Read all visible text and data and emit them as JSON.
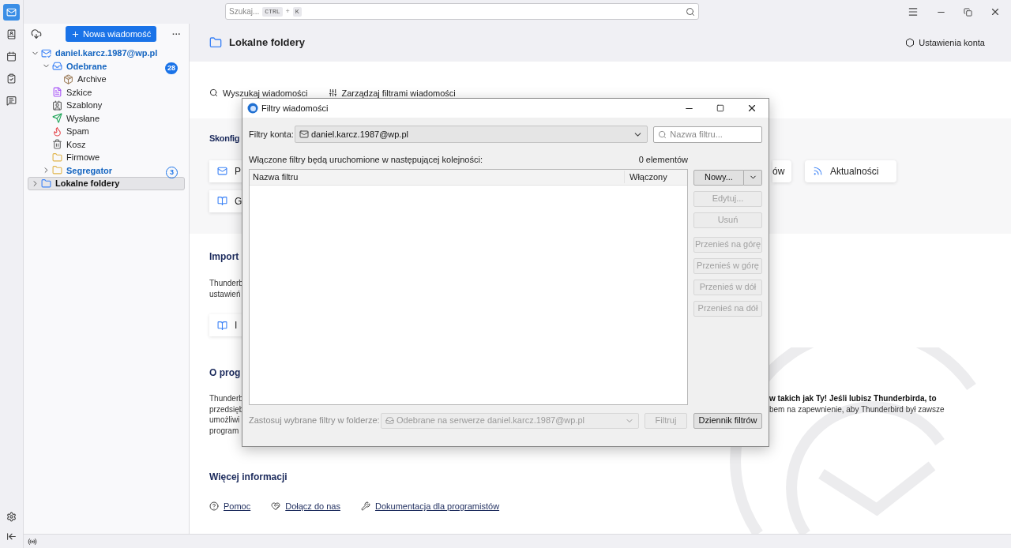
{
  "top_bar": {
    "search": {
      "placeholder": "Szukaj...",
      "keys": [
        "CTRL",
        "+",
        "K"
      ]
    }
  },
  "spaces": [
    {
      "kind": "mail",
      "selected": true
    },
    {
      "kind": "contacts",
      "selected": false
    },
    {
      "kind": "calendar",
      "selected": false
    },
    {
      "kind": "tasks",
      "selected": false
    },
    {
      "kind": "chat",
      "selected": false
    }
  ],
  "folder_pane": {
    "new_button": "Nowa wiadomość",
    "more": "···",
    "tree": [
      {
        "label": "daniel.karcz.1987@wp.pl",
        "kind": "account",
        "expanded": true,
        "unread": true,
        "selected": false,
        "children": [
          {
            "label": "Odebrane",
            "kind": "inbox",
            "expanded": true,
            "unread": true,
            "selected": false,
            "count": "28",
            "filled": true,
            "children": [
              {
                "label": "Archive",
                "kind": "archive",
                "unread": false,
                "selected": false
              }
            ]
          },
          {
            "label": "Szkice",
            "kind": "drafts",
            "unread": false,
            "selected": false
          },
          {
            "label": "Szablony",
            "kind": "templates",
            "unread": false,
            "selected": false
          },
          {
            "label": "Wysłane",
            "kind": "sent",
            "unread": false,
            "selected": false
          },
          {
            "label": "Spam",
            "kind": "spam",
            "unread": false,
            "selected": false
          },
          {
            "label": "Kosz",
            "kind": "trash",
            "unread": false,
            "selected": false
          },
          {
            "label": "Firmowe",
            "kind": "folder",
            "unread": false,
            "selected": false
          },
          {
            "label": "Segregator",
            "kind": "folder",
            "expanded": false,
            "unread": true,
            "selected": false,
            "count": "3",
            "filled": false
          }
        ]
      },
      {
        "label": "Lokalne foldery",
        "kind": "local",
        "expanded": false,
        "unread": false,
        "selected": true
      }
    ]
  },
  "main": {
    "title": "Lokalne foldery",
    "account_settings": "Ustawienia konta",
    "actions": [
      "Wyszukaj wiadomości",
      "Zarządzaj filtrami wiadomości"
    ],
    "setup_heading": "Skonfig",
    "setup_cards_left": [
      {
        "label": "P",
        "kind": "mail"
      },
      {
        "label": "G",
        "kind": "address"
      }
    ],
    "setup_cards_right": [
      {
        "label": "ów",
        "kind": "none"
      },
      {
        "label": "Aktualności",
        "kind": "feed"
      }
    ],
    "import_heading": "Import",
    "import_text": [
      "Thunderb",
      "ustawień"
    ],
    "import_card": "I",
    "about_heading": "O prog",
    "about_text_left": [
      "Thunderb",
      "przedsięb",
      "umożliwi",
      "program"
    ],
    "about_text_right": [
      "w takich jak Ty! Jeśli lubisz Thunderbirda, to",
      "bem na zapewnienie, aby Thunderbird był zawsze"
    ],
    "more_heading": "Więcej informacji",
    "links": [
      {
        "label": "Pomoc",
        "kind": "help"
      },
      {
        "label": "Dołącz do nas",
        "kind": "heart"
      },
      {
        "label": "Dokumentacja dla programistów",
        "kind": "wrench"
      }
    ]
  },
  "dialog": {
    "title": "Filtry wiadomości",
    "account_label": "Filtry konta:",
    "account": "daniel.karcz.1987@wp.pl",
    "search_placeholder": "Nazwa filtru...",
    "order_label": "Włączone filtry będą uruchomione w następującej kolejności:",
    "count": "0 elementów",
    "columns": [
      "Nazwa filtru",
      "Włączony"
    ],
    "action_buttons": [
      {
        "label": "Nowy...",
        "kind": "split",
        "disabled": false
      },
      {
        "label": "Edytuj...",
        "kind": "plain",
        "disabled": true
      },
      {
        "label": "Usuń",
        "kind": "plain",
        "disabled": true
      }
    ],
    "move_buttons": [
      {
        "label": "Przenieś na górę",
        "disabled": true
      },
      {
        "label": "Przenieś w górę",
        "disabled": true
      },
      {
        "label": "Przenieś w dół",
        "disabled": true
      },
      {
        "label": "Przenieś na dół",
        "disabled": true
      }
    ],
    "apply_label": "Zastosuj wybrane filtry w folderze:",
    "apply_folder": "Odebrane na serwerze daniel.karcz.1987@wp.pl",
    "apply_disabled": true,
    "run_button": {
      "label": "Filtruj",
      "disabled": true
    },
    "log_button": {
      "label": "Dziennik filtrów",
      "disabled": false
    }
  }
}
